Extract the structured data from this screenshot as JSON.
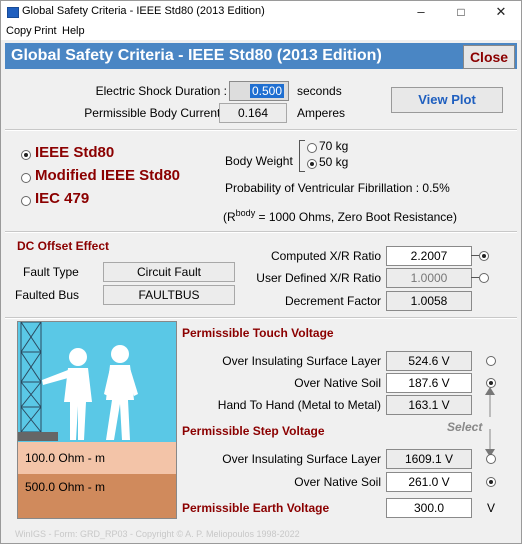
{
  "window": {
    "title": "Global Safety Criteria - IEEE Std80 (2013 Edition)",
    "controls": {
      "minimize": "–",
      "maximize": "□",
      "close": "✕"
    }
  },
  "menu": [
    "Copy",
    "Print",
    "Help"
  ],
  "banner": {
    "title": "Global Safety Criteria - IEEE Std80 (2013 Edition)",
    "close_label": "Close"
  },
  "shock": {
    "duration_label": "Electric Shock Duration :",
    "duration_value": "0.500",
    "duration_unit": "seconds",
    "current_label": "Permissible Body Current :",
    "current_value": "0.164",
    "current_unit": "Amperes",
    "view_plot": "View Plot"
  },
  "standards": {
    "options": [
      "IEEE Std80",
      "Modified IEEE Std80",
      "IEC 479"
    ],
    "selected": "IEEE Std80"
  },
  "body_weight": {
    "label": "Body Weight",
    "options": [
      "70 kg",
      "50 kg"
    ],
    "selected": "50 kg"
  },
  "fibrillation": {
    "text": "Probability of Ventricular Fibrillation : 0.5%"
  },
  "resistance_note": {
    "prefix": "(R",
    "superscript": "body",
    "suffix": " = 1000 Ohms, Zero Boot Resistance)"
  },
  "dc_offset": {
    "heading": "DC Offset Effect",
    "fault_type_label": "Fault Type",
    "fault_type_value": "Circuit Fault",
    "faulted_bus_label": "Faulted Bus",
    "faulted_bus_value": "FAULTBUS",
    "computed_xr_label": "Computed X/R Ratio",
    "computed_xr_value": "2.2007",
    "user_xr_label": "User Defined X/R Ratio",
    "user_xr_value": "1.0000",
    "decrement_label": "Decrement Factor",
    "decrement_value": "1.0058",
    "xr_selected": "computed"
  },
  "touch": {
    "heading": "Permissible Touch Voltage",
    "insulating_label": "Over Insulating Surface Layer",
    "insulating_value": "524.6 V",
    "native_label": "Over Native Soil",
    "native_value": "187.6 V",
    "hand_label": "Hand To Hand (Metal to Metal)",
    "hand_value": "163.1 V",
    "selected": "native"
  },
  "select_label": "Select",
  "step": {
    "heading": "Permissible Step Voltage",
    "insulating_label": "Over Insulating Surface Layer",
    "insulating_value": "1609.1 V",
    "native_label": "Over Native Soil",
    "native_value": "261.0 V",
    "selected": "native"
  },
  "earth": {
    "heading": "Permissible Earth Voltage",
    "value": "300.0",
    "unit": "V"
  },
  "soil": {
    "surface": "100.0 Ohm - m",
    "native": "500.0 Ohm - m",
    "colors": {
      "sky": "#5ac8e6",
      "surface": "#f3c4a8",
      "native": "#d08a5c"
    }
  },
  "footer": "WinIGS - Form: GRD_RP03 - Copyright © A. P. Meliopoulos 1998-2022"
}
